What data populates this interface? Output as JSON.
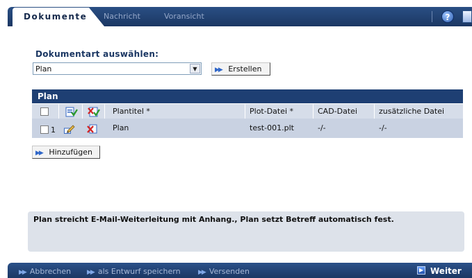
{
  "tabs": {
    "active": "Dokumente",
    "items": [
      "Nachricht",
      "Voransicht"
    ]
  },
  "icons": {
    "help": "help-icon",
    "doc": "document-icon",
    "chevron": "double-chevron-right-icon",
    "dropdown": "dropdown-arrow-icon",
    "edit": "edit-pencil-icon",
    "delete": "delete-x-icon",
    "select_all": "select-all-icon",
    "deselect": "deselect-icon"
  },
  "doctype": {
    "label": "Dokumentart auswählen:",
    "selected": "Plan",
    "create_button": "Erstellen"
  },
  "plan_table": {
    "title": "Plan",
    "columns": [
      "Plantitel *",
      "Plot-Datei *",
      "CAD-Datei",
      "zusätzliche Datei"
    ],
    "rows": [
      {
        "index": "1",
        "plantitel": "Plan",
        "plot_datei": "test-001.plt",
        "cad_datei": "-/-",
        "zusatz_datei": "-/-"
      }
    ],
    "add_button": "Hinzufügen"
  },
  "info": {
    "text": "Plan streicht E-Mail-Weiterleitung mit Anhang., Plan setzt Betreff automatisch fest."
  },
  "footer": {
    "cancel": "Abbrechen",
    "save_draft": "als Entwurf speichern",
    "send": "Versenden",
    "next": "Weiter"
  },
  "colors": {
    "navy": "#1e3f73",
    "header_row": "#d6dde9",
    "data_row": "#c9d2e2",
    "info_bg": "#dde2ea"
  }
}
